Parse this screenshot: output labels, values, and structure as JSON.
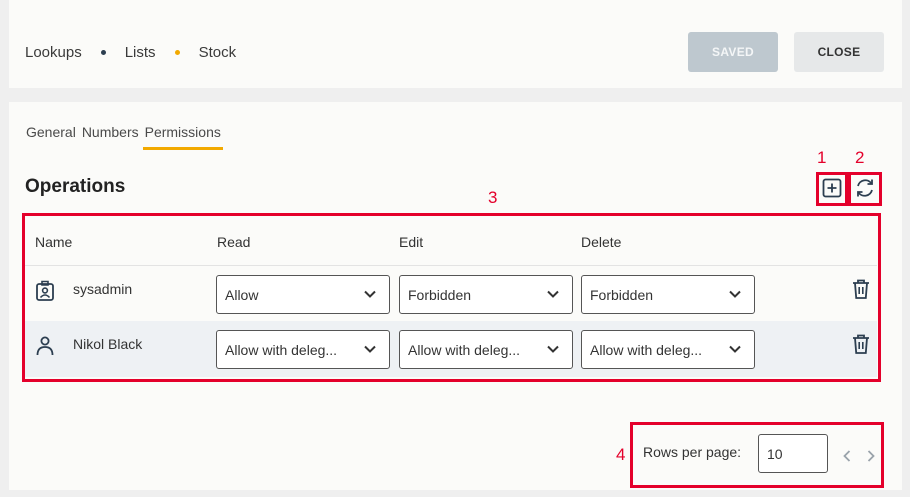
{
  "breadcrumb": [
    {
      "label": "Lookups",
      "dot_color": "#2c3e50"
    },
    {
      "label": "Lists",
      "dot_color": "#f2a900"
    },
    {
      "label": "Stock"
    }
  ],
  "toolbar": {
    "saved_label": "SAVED",
    "close_label": "CLOSE"
  },
  "tabs": [
    {
      "label": "General",
      "active": false
    },
    {
      "label": "Numbers",
      "active": false
    },
    {
      "label": "Permissions",
      "active": true
    }
  ],
  "section": {
    "title": "Operations"
  },
  "annotations": [
    "1",
    "2",
    "3",
    "4"
  ],
  "table": {
    "headers": [
      "Name",
      "Read",
      "Edit",
      "Delete"
    ],
    "rows": [
      {
        "name": "sysadmin",
        "icon": "user-badge-icon",
        "read": "Allow",
        "edit": "Forbidden",
        "delete": "Forbidden"
      },
      {
        "name": "Nikol Black",
        "icon": "user-icon",
        "read": "Allow with deleg...",
        "edit": "Allow with deleg...",
        "delete": "Allow with deleg..."
      }
    ]
  },
  "pagination": {
    "rows_label": "Rows per page:",
    "rows_value": "10"
  },
  "colors": {
    "accent": "#f2a900",
    "annotation": "#e4002b",
    "saved_button": "#bec8cf"
  }
}
